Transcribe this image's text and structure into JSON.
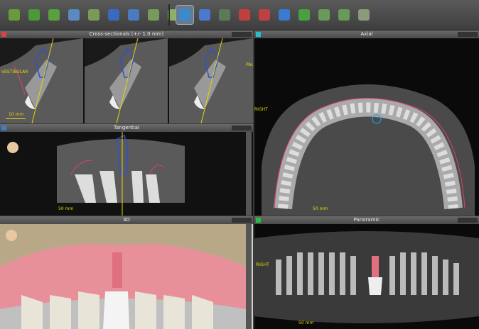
{
  "toolbar": {
    "buttons": [
      {
        "name": "measure-tool-icon",
        "color": "#6a9a3a"
      },
      {
        "name": "implant-green-icon",
        "color": "#4a9a3a"
      },
      {
        "name": "implant-group-icon",
        "color": "#5aa040"
      },
      {
        "name": "implant-blue-icon",
        "color": "#5a8ac0"
      },
      {
        "name": "implant-rotate-icon",
        "color": "#7a9a5a"
      },
      {
        "name": "cylinder-icon",
        "color": "#3a6ac0"
      },
      {
        "name": "drill-icon",
        "color": "#4a7ac0"
      },
      {
        "name": "abutment-icon",
        "color": "#7a9a5a"
      },
      {
        "name": "crown-icon",
        "color": "#8ab060"
      }
    ],
    "buttons2": [
      {
        "name": "orient-icon",
        "color": "#3a8ad0"
      },
      {
        "name": "cube-arrow-icon",
        "color": "#4a7ad0"
      },
      {
        "name": "curve-icon",
        "color": "#5a7a5a"
      },
      {
        "name": "wand-icon",
        "color": "#c04040"
      },
      {
        "name": "eraser-icon",
        "color": "#c04040"
      },
      {
        "name": "box-icon",
        "color": "#3a7ad0"
      },
      {
        "name": "undo-icon",
        "color": "#4aa040"
      },
      {
        "name": "tooth-a-icon",
        "color": "#6a9a5a"
      },
      {
        "name": "tooth-b-icon",
        "color": "#6a9a5a"
      },
      {
        "name": "tooth-c-icon",
        "color": "#8a9a7a"
      }
    ]
  },
  "panels": {
    "cross": {
      "title": "Cross-sectionals (+/- 1.0 mm)",
      "scale": "10 mm",
      "left_label": "VESTIBULAR",
      "right_label": "PALATAL"
    },
    "axial": {
      "title": "Axial",
      "side_label": "RIGHT",
      "scale": "50 mm"
    },
    "tangential": {
      "title": "Tangential",
      "scale": "50 mm"
    },
    "three_d": {
      "title": "3D"
    },
    "panoramic": {
      "title": "Panoramic",
      "scale": "50 mm",
      "side_label": "RIGHT"
    }
  },
  "colors": {
    "accent_red": "#e04040",
    "accent_cyan": "#20c0d0",
    "accent_green": "#20c040",
    "accent_blue": "#4080c0",
    "label_yellow": "#e8d800",
    "gum_pink": "#e8909a"
  }
}
